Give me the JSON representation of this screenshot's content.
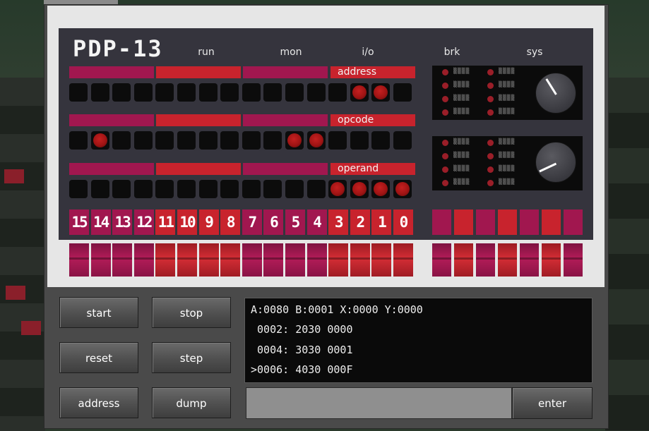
{
  "title": "PDP-13",
  "columns": [
    "run",
    "mon",
    "i/o",
    "brk",
    "sys"
  ],
  "rows": [
    {
      "label": "address",
      "leds": [
        0,
        0,
        0,
        0,
        0,
        0,
        0,
        0,
        0,
        0,
        0,
        0,
        0,
        1,
        1,
        0
      ]
    },
    {
      "label": "opcode",
      "leds": [
        0,
        1,
        0,
        0,
        0,
        0,
        0,
        0,
        0,
        0,
        1,
        1,
        0,
        0,
        0,
        0
      ]
    },
    {
      "label": "operand",
      "leds": [
        0,
        0,
        0,
        0,
        0,
        0,
        0,
        0,
        0,
        0,
        0,
        0,
        1,
        1,
        1,
        1
      ]
    }
  ],
  "bit_labels": [
    "15",
    "14",
    "13",
    "12",
    "11",
    "10",
    "9",
    "8",
    "7",
    "6",
    "5",
    "4",
    "3",
    "2",
    "1",
    "0"
  ],
  "colors": {
    "magenta": "#a1174f",
    "red": "#c8232d",
    "led_on": "#c52020"
  },
  "buttons": {
    "start": "start",
    "stop": "stop",
    "reset": "reset",
    "step": "step",
    "address": "address",
    "dump": "dump",
    "enter": "enter"
  },
  "terminal": {
    "lines": [
      "A:0080 B:0001 X:0000 Y:0000",
      " 0002: 2030 0000",
      " 0004: 3030 0001",
      ">0006: 4030 000F"
    ]
  },
  "input": {
    "value": "",
    "placeholder": ""
  }
}
